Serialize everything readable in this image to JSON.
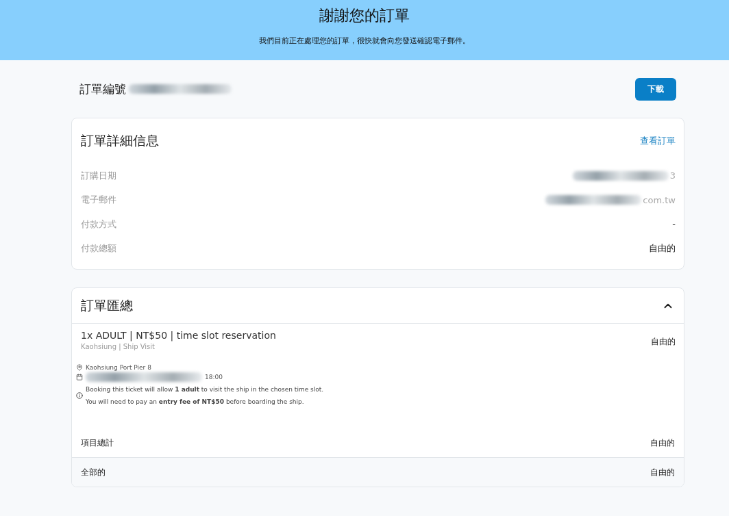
{
  "header": {
    "title": "謝謝您的訂單",
    "subtitle": "我們目前正在處理您的訂單，很快就會向您發送確認電子郵件。"
  },
  "order": {
    "number_label": "訂單編號",
    "download_button": "下載"
  },
  "details": {
    "title": "訂單詳細信息",
    "link": "查看訂單",
    "rows": [
      {
        "label": "訂購日期",
        "value": "3",
        "redacted": true
      },
      {
        "label": "電子郵件",
        "value": "com.tw",
        "redacted": true
      },
      {
        "label": "付款方式",
        "value": "-",
        "redacted": false
      },
      {
        "label": "付款總額",
        "value": "自由的",
        "redacted": false
      }
    ]
  },
  "summary": {
    "title": "訂單匯總",
    "expanded": true,
    "item": {
      "title": "1x ADULT | NT$50 | time slot reservation",
      "subtitle": "Kaohsiung | Ship Visit",
      "price": "自由的",
      "location": "Kaohsiung Port Pier 8",
      "time": "18:00",
      "notes": [
        "Booking this ticket will allow **1 adult** to visit the ship in the chosen time slot.",
        "You will need to pay an **entry fee of NT$50** before boarding the ship."
      ]
    },
    "totals": [
      {
        "label": "項目總計",
        "value": "自由的",
        "shaded": false
      },
      {
        "label": "全部的",
        "value": "自由的",
        "shaded": true
      }
    ]
  }
}
